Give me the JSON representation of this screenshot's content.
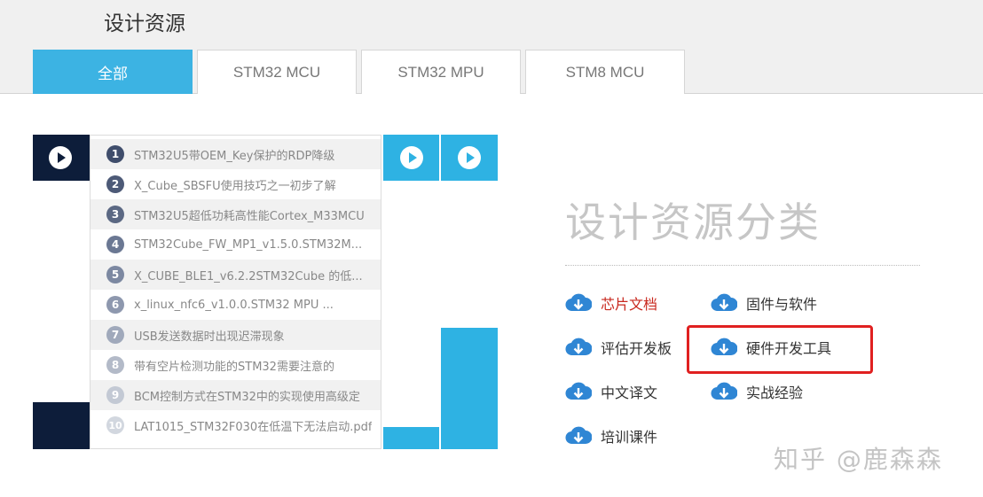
{
  "header": {
    "title": "设计资源"
  },
  "tabs": [
    {
      "label": "全部",
      "active": true
    },
    {
      "label": "STM32 MCU",
      "active": false
    },
    {
      "label": "STM32 MPU",
      "active": false
    },
    {
      "label": "STM8 MCU",
      "active": false
    }
  ],
  "colors": {
    "accent": "#3cb3e3",
    "dark": "#0d1d3a",
    "highlight": "#e02020",
    "hot_link": "#c8281e"
  },
  "resource_list": [
    {
      "number": "1",
      "title": "STM32U5带OEM_Key保护的RDP降级"
    },
    {
      "number": "2",
      "title": "X_Cube_SBSFU使用技巧之一初步了解"
    },
    {
      "number": "3",
      "title": "STM32U5超低功耗高性能Cortex_M33MCU"
    },
    {
      "number": "4",
      "title": "STM32Cube_FW_MP1_v1.5.0.STM32M..."
    },
    {
      "number": "5",
      "title": "X_CUBE_BLE1_v6.2.2STM32Cube 的低..."
    },
    {
      "number": "6",
      "title": "x_linux_nfc6_v1.0.0.STM32 MPU ..."
    },
    {
      "number": "7",
      "title": "USB发送数据时出现迟滞现象"
    },
    {
      "number": "8",
      "title": "带有空片检测功能的STM32需要注意的"
    },
    {
      "number": "9",
      "title": "BCM控制方式在STM32中的实现使用高级定"
    },
    {
      "number": "10",
      "title": "LAT1015_STM32F030在低温下无法启动.pdf"
    }
  ],
  "categories": {
    "title": "设计资源分类",
    "items": [
      {
        "label": "芯片文档",
        "icon": "download-cloud-icon"
      },
      {
        "label": "固件与软件",
        "icon": "download-cloud-icon"
      },
      {
        "label": "评估开发板",
        "icon": "download-cloud-icon"
      },
      {
        "label": "硬件开发工具",
        "icon": "download-cloud-icon"
      },
      {
        "label": "中文译文",
        "icon": "download-cloud-icon"
      },
      {
        "label": "实战经验",
        "icon": "download-cloud-icon"
      },
      {
        "label": "培训课件",
        "icon": "download-cloud-icon"
      }
    ]
  },
  "watermark": "知乎 @鹿森森"
}
